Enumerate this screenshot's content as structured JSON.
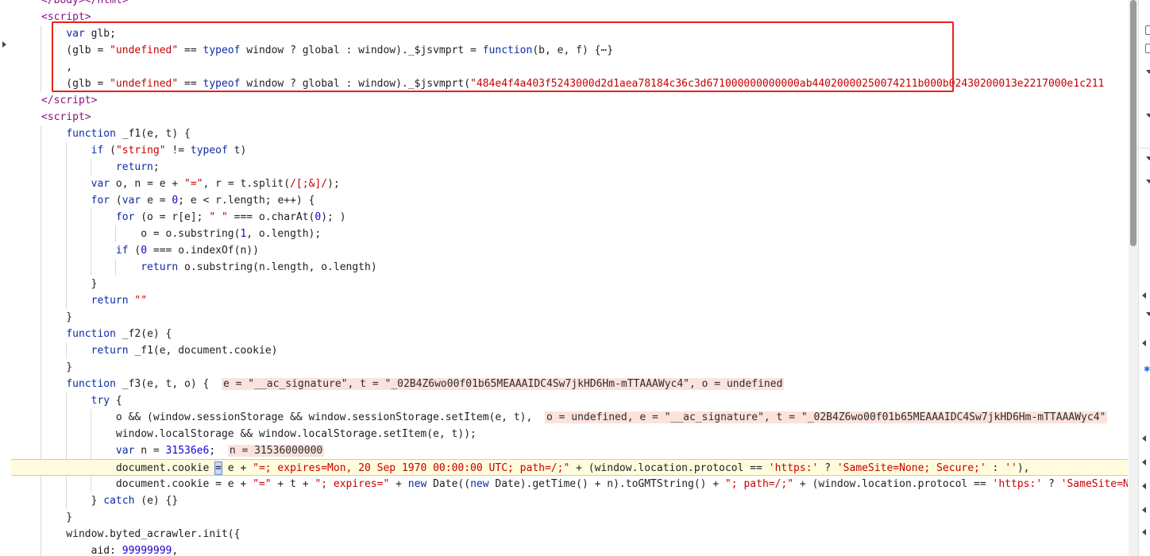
{
  "editor": {
    "lines": [
      {
        "html": "<span class=\"tag\">&lt;/body&gt;&lt;/html&gt;</span>"
      },
      {
        "html": "<span class=\"tag\">&lt;script&gt;</span>"
      },
      {
        "html": "    <span class=\"kw\">var</span> glb;"
      },
      {
        "html": "    (glb = <span class=\"str\">\"undefined\"</span> == <span class=\"kw\">typeof</span> window ? global : window)._$jsvmprt = <span class=\"kw\">function</span>(b, e, f) {⋯}"
      },
      {
        "html": "    ,"
      },
      {
        "html": "    (glb = <span class=\"str\">\"undefined\"</span> == <span class=\"kw\">typeof</span> window ? global : window)._$jsvmprt(<span class=\"str\">\"484e4f4a403f5243000d2d1aea78184c36c3d671000000000000ab44020000250074211b000b02430200013e2217000e1c211</span>"
      },
      {
        "html": "<span class=\"tag\">&lt;/script&gt;</span>"
      },
      {
        "html": "<span class=\"tag\">&lt;script&gt;</span>"
      },
      {
        "html": "    <span class=\"kw\">function</span> _f1(e, t) {"
      },
      {
        "html": "        <span class=\"kw\">if</span> (<span class=\"str\">\"string\"</span> != <span class=\"kw\">typeof</span> t)"
      },
      {
        "html": "            <span class=\"kw\">return</span>;"
      },
      {
        "html": "        <span class=\"kw\">var</span> o, n = e + <span class=\"str\">\"=\"</span>, r = t.split(<span class=\"re\">/[;&amp;]/</span>);"
      },
      {
        "html": "        <span class=\"kw\">for</span> (<span class=\"kw\">var</span> e = <span class=\"num\">0</span>; e &lt; r.length; e++) {"
      },
      {
        "html": "            <span class=\"kw\">for</span> (o = r[e]; <span class=\"str\">\" \"</span> === o.charAt(<span class=\"num\">0</span>); )"
      },
      {
        "html": "                o = o.substring(<span class=\"num\">1</span>, o.length);"
      },
      {
        "html": "            <span class=\"kw\">if</span> (<span class=\"num\">0</span> === o.indexOf(n))"
      },
      {
        "html": "                <span class=\"kw\">return</span> o.substring(n.length, o.length)"
      },
      {
        "html": "        }"
      },
      {
        "html": "        <span class=\"kw\">return</span> <span class=\"str\">\"\"</span>"
      },
      {
        "html": "    }"
      },
      {
        "html": "    <span class=\"kw\">function</span> _f2(e) {"
      },
      {
        "html": "        <span class=\"kw\">return</span> _f1(e, document.cookie)"
      },
      {
        "html": "    }"
      },
      {
        "html": "    <span class=\"kw\">function</span> _f3(e, t, o) {  <span class=\"inline-val\">e = \"__ac_signature\", t = \"_02B4Z6wo00f01b65MEAAAIDC4Sw7jkHD6Hm-mTTAAAWyc4\", o = undefined</span>"
      },
      {
        "html": "        <span class=\"kw\">try</span> {"
      },
      {
        "html": "            o &amp;&amp; (window.sessionStorage &amp;&amp; window.sessionStorage.setItem(e, t),  <span class=\"inline-val\">o = undefined, e = \"__ac_signature\", t = \"_02B4Z6wo00f01b65MEAAAIDC4Sw7jkHD6Hm-mTTAAAWyc4\"</span>"
      },
      {
        "html": "            window.localStorage &amp;&amp; window.localStorage.setItem(e, t));"
      },
      {
        "html": "            <span class=\"kw\">var</span> n = <span class=\"num\">31536e6</span>;  <span class=\"inline-val\">n = 31536000000</span>"
      },
      {
        "html": "            document.cookie <span class=\"cursor\">=</span> e + <span class=\"str\">\"=; expires=Mon, 20 Sep 1970 00:00:00 UTC; path=/;\"</span> + (window.location.protocol == <span class=\"str\">'https:'</span> ? <span class=\"str\">'SameSite=None; Secure;'</span> : <span class=\"str\">''</span>),"
      },
      {
        "html": "            document.cookie = e + <span class=\"str\">\"=\"</span> + t + <span class=\"str\">\"; expires=\"</span> + <span class=\"kw\">new</span> Date((<span class=\"kw\">new</span> Date).getTime() + n).toGMTString() + <span class=\"str\">\"; path=/;\"</span> + (window.location.protocol == <span class=\"str\">'https:'</span> ? <span class=\"str\">'SameSite=None; Secure;'</span> : <span class=\"str\">''</span>)"
      },
      {
        "html": "        } <span class=\"kw\">catch</span> (e) {}"
      },
      {
        "html": "    }"
      },
      {
        "html": "    window.byted_acrawler.init({"
      },
      {
        "html": "        aid: <span class=\"num\">99999999</span>,"
      }
    ],
    "execution_line_index": 28
  }
}
